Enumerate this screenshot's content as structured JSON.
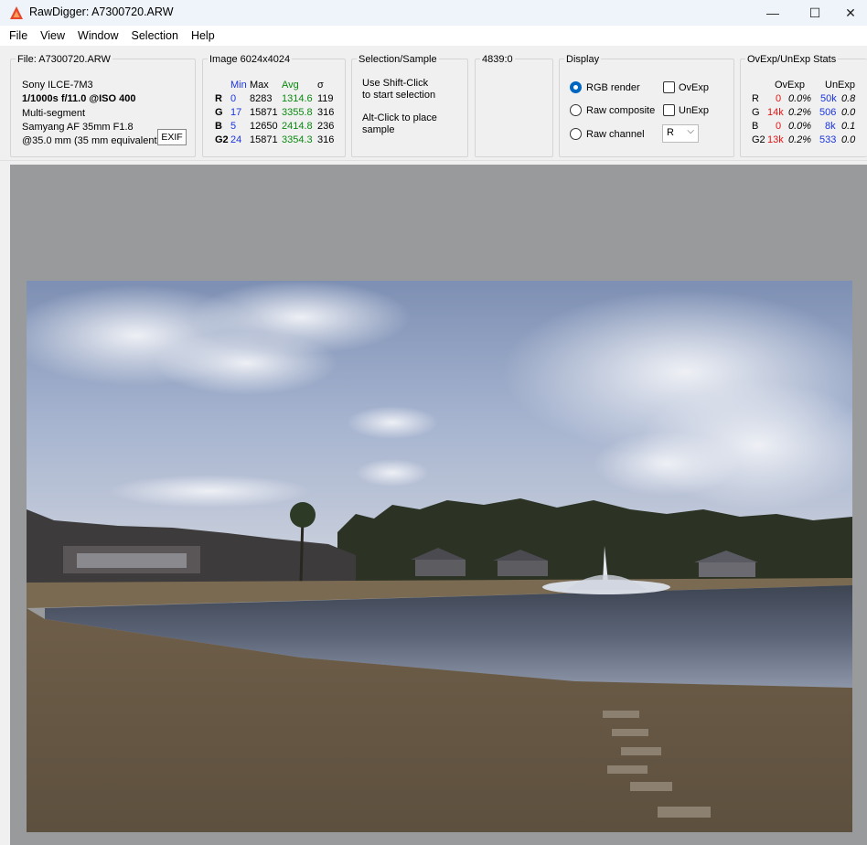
{
  "window": {
    "title": "RawDigger: A7300720.ARW",
    "minimize": "—",
    "maximize": "☐",
    "close": "✕"
  },
  "menu": [
    "File",
    "View",
    "Window",
    "Selection",
    "Help"
  ],
  "file": {
    "label": "File: A7300720.ARW",
    "camera": "Sony ILCE-7M3",
    "exposure": "1/1000s f/11.0 @ISO 400",
    "mode": "Multi-segment",
    "lens": "Samyang AF 35mm F1.8",
    "focal": "@35.0 mm (35 mm equivalent:",
    "exif_button": "EXIF"
  },
  "image": {
    "label": "Image 6024x4024",
    "headers": [
      "Min",
      "Max",
      "Avg",
      "σ"
    ],
    "rows": [
      {
        "ch": "R",
        "min": "0",
        "max": "8283",
        "avg": "1314.6",
        "sd": "119"
      },
      {
        "ch": "G",
        "min": "17",
        "max": "15871",
        "avg": "3355.8",
        "sd": "316"
      },
      {
        "ch": "B",
        "min": "5",
        "max": "12650",
        "avg": "2414.8",
        "sd": "236"
      },
      {
        "ch": "G2",
        "min": "24",
        "max": "15871",
        "avg": "3354.3",
        "sd": "316"
      }
    ]
  },
  "selection": {
    "label": "Selection/Sample",
    "line1": "Use Shift-Click",
    "line2": "to start selection",
    "line3": "Alt-Click to place",
    "line4": "sample"
  },
  "coords": {
    "value": "4839:0"
  },
  "display": {
    "label": "Display",
    "rgb_render": "RGB render",
    "raw_composite": "Raw composite",
    "raw_channel": "Raw channel",
    "ovexp": "OvExp",
    "unexp": "UnExp",
    "channel_value": "R",
    "selected": "RGB render"
  },
  "stats": {
    "label": "OvExp/UnExp Stats",
    "headers": [
      "OvExp",
      "UnExp"
    ],
    "rows": [
      {
        "ch": "R",
        "ov": "0",
        "ovp": "0.0%",
        "un": "50k",
        "unp": "0.8"
      },
      {
        "ch": "G",
        "ov": "14k",
        "ovp": "0.2%",
        "un": "506",
        "unp": "0.0"
      },
      {
        "ch": "B",
        "ov": "0",
        "ovp": "0.0%",
        "un": "8k",
        "unp": "0.1"
      },
      {
        "ch": "G2",
        "ov": "13k",
        "ovp": "0.2%",
        "un": "533",
        "unp": "0.0"
      }
    ]
  },
  "colors": {
    "accent": "#0067c0",
    "min": "#1a35e0",
    "avg": "#0a8a10",
    "over": "#e01515",
    "viewport": "#999a9c"
  }
}
